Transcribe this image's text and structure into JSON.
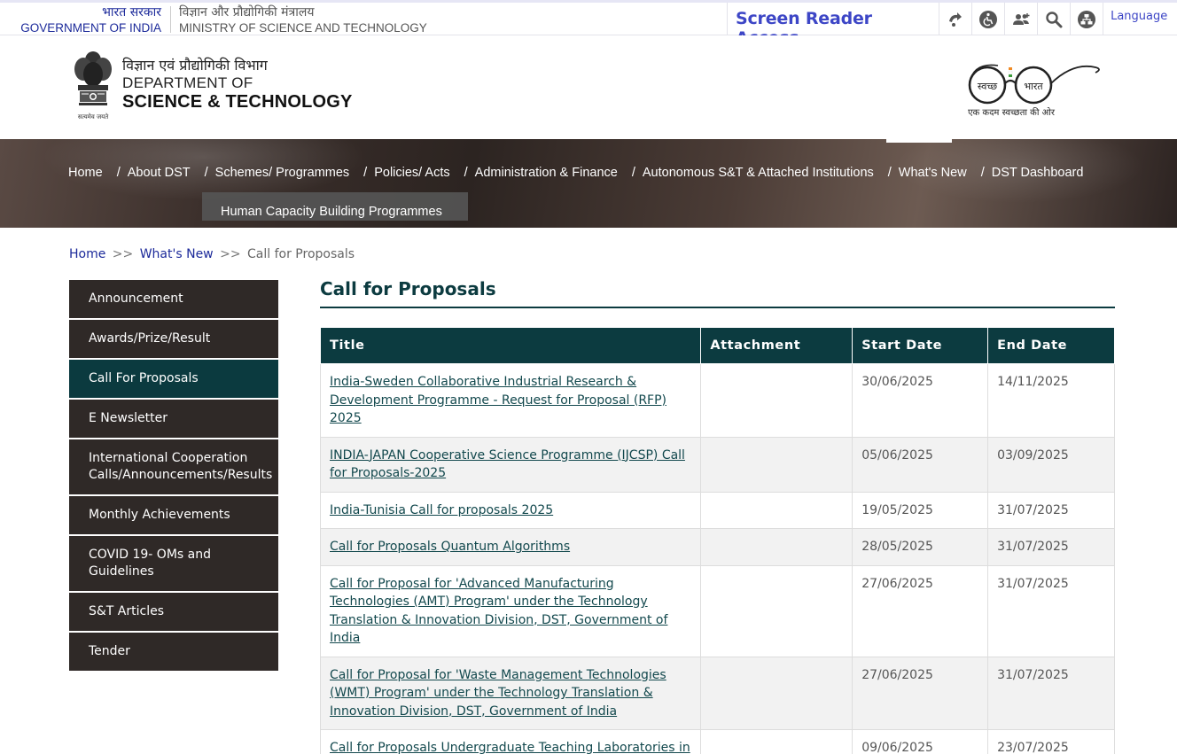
{
  "gov_bar": {
    "gov_hi": "भारत सरकार",
    "gov_en": "GOVERNMENT OF INDIA",
    "ministry_hi": "विज्ञान और प्रौद्योगिकी मंत्रालय",
    "ministry_en": "MINISTRY OF SCIENCE AND TECHNOLOGY",
    "screen_reader": "Screen Reader Access",
    "language": "Language",
    "tool_icons": [
      "skip-to-content-icon",
      "accessibility-icon",
      "social-users-icon",
      "search-icon",
      "sitemap-icon"
    ]
  },
  "header": {
    "dept_hi": "विज्ञान एवं प्रौद्योगिकी विभाग",
    "dept_line1": "DEPARTMENT OF",
    "dept_line2": "SCIENCE & TECHNOLOGY",
    "emblem_motto": "सत्यमेव जयते",
    "swachh_left": "स्वच्छ",
    "swachh_right": "भारत",
    "swachh_tagline": "एक कदम स्वच्छता की ओर"
  },
  "nav": {
    "items": [
      {
        "label": "Home"
      },
      {
        "label": "About DST"
      },
      {
        "label": "Schemes/ Programmes"
      },
      {
        "label": "Policies/ Acts"
      },
      {
        "label": "Administration & Finance"
      },
      {
        "label": "Autonomous S&T & Attached Institutions"
      },
      {
        "label": "What's New"
      },
      {
        "label": "DST Dashboard"
      }
    ],
    "submenu_label": "Human Capacity Building Programmes"
  },
  "breadcrumb": {
    "home": "Home",
    "sep": ">>",
    "whats_new": "What's New",
    "current": "Call for Proposals"
  },
  "sidebar": {
    "items": [
      {
        "label": "Announcement"
      },
      {
        "label": "Awards/Prize/Result"
      },
      {
        "label": "Call For Proposals"
      },
      {
        "label": "E Newsletter"
      },
      {
        "label": "International Cooperation Calls/Announcements/Results"
      },
      {
        "label": "Monthly Achievements"
      },
      {
        "label": "COVID 19- OMs and Guidelines"
      },
      {
        "label": "S&T Articles"
      },
      {
        "label": "Tender"
      }
    ]
  },
  "main": {
    "title": "Call for Proposals",
    "columns": {
      "title": "Title",
      "attachment": "Attachment",
      "start": "Start Date",
      "end": "End Date"
    },
    "rows": [
      {
        "title": "India-Sweden Collaborative Industrial Research & Development Programme - Request for Proposal (RFP) 2025",
        "attachment": "",
        "start": "30/06/2025",
        "end": "14/11/2025"
      },
      {
        "title": "INDIA-JAPAN Cooperative Science Programme (IJCSP) Call for Proposals-2025",
        "attachment": "",
        "start": "05/06/2025",
        "end": "03/09/2025"
      },
      {
        "title": "India-Tunisia Call for proposals 2025",
        "attachment": "",
        "start": "19/05/2025",
        "end": "31/07/2025"
      },
      {
        "title": "Call for Proposals Quantum Algorithms",
        "attachment": "",
        "start": "28/05/2025",
        "end": "31/07/2025"
      },
      {
        "title": "Call for Proposal for 'Advanced Manufacturing Technologies (AMT) Program' under the Technology Translation & Innovation Division, DST, Government of India",
        "attachment": "",
        "start": "27/06/2025",
        "end": "31/07/2025"
      },
      {
        "title": "Call for Proposal for 'Waste Management Technologies (WMT) Program' under the Technology Translation & Innovation Division, DST, Government of India",
        "attachment": "",
        "start": "27/06/2025",
        "end": "31/07/2025"
      },
      {
        "title": "Call for Proposals Undergraduate Teaching Laboratories in Quantum Technologies",
        "attachment": "",
        "start": "09/06/2025",
        "end": "23/07/2025"
      }
    ]
  },
  "colors": {
    "accent_teal": "#0c3b40",
    "sidebar_dark": "#2f2927",
    "link_blue": "#1c2a9a",
    "screen_reader_blue": "#3d46c6"
  }
}
